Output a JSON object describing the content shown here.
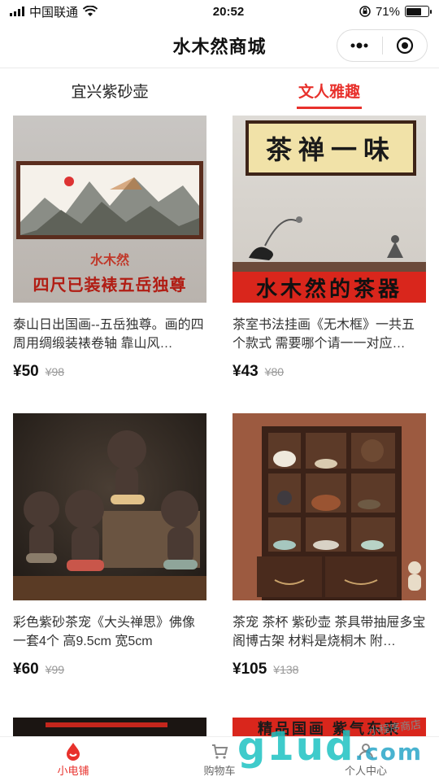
{
  "status_bar": {
    "carrier": "中国联通",
    "time": "20:52",
    "battery": "71%",
    "battery_level": 0.71
  },
  "header": {
    "title": "水木然商城",
    "more_icon": "more-dots-icon",
    "close_icon": "target-circle-icon"
  },
  "tabs": [
    {
      "label": "宜兴紫砂壶",
      "active": false
    },
    {
      "label": "文人雅趣",
      "active": true
    }
  ],
  "products": [
    {
      "name": "泰山日出国画--五岳独尊。画的四周用绸缎装裱卷轴 靠山风…",
      "price": "¥50",
      "original_price": "¥98",
      "image_text": {
        "brand": "水木然",
        "caption": "四尺已装裱五岳独尊"
      }
    },
    {
      "name": "茶室书法挂画《无木框》一共五个款式 需要哪个请一一对应…",
      "price": "¥43",
      "original_price": "¥80",
      "image_text": {
        "scroll": "茶禅一味",
        "banner": "水木然的茶器"
      }
    },
    {
      "name": "彩色紫砂茶宠《大头禅思》佛像一套4个 高9.5cm 宽5cm",
      "price": "¥60",
      "original_price": "¥99",
      "image_text": {}
    },
    {
      "name": "茶宠 茶杯 紫砂壶 茶具带抽屉多宝阁博古架 材料是烧桐木 附…",
      "price": "¥105",
      "original_price": "¥138",
      "image_text": {}
    }
  ],
  "peek": {
    "right_text": "精品国画 紫气东来"
  },
  "bottom_nav": [
    {
      "label": "小电铺",
      "icon": "drop-logo-icon",
      "active": true
    },
    {
      "label": "购物车",
      "icon": "cart-icon",
      "active": false
    },
    {
      "label": "个人中心",
      "icon": "user-icon",
      "active": false
    }
  ],
  "watermark": {
    "text": "g1ud",
    "suffix": ".com",
    "note": "小程序商店"
  },
  "colors": {
    "accent": "#e8312c",
    "banner_red": "#d9261c"
  }
}
